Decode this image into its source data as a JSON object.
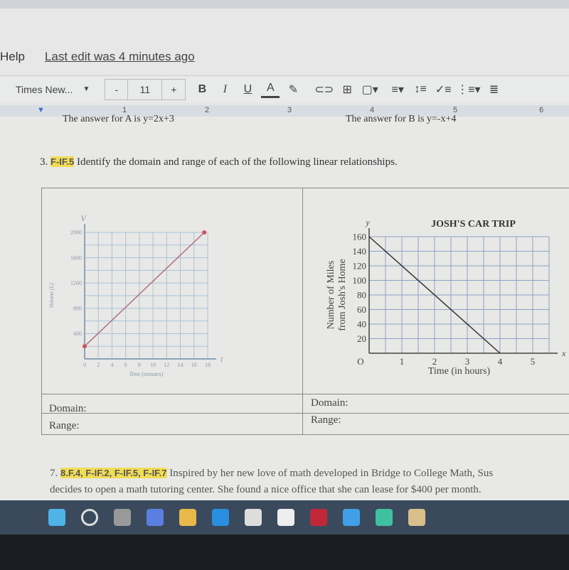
{
  "menu": {
    "help": "Help",
    "last_edit": "Last edit was 4 minutes ago"
  },
  "toolbar": {
    "font": "Times New...",
    "font_size": "11",
    "minus": "-",
    "plus": "+",
    "bold": "B",
    "italic": "I",
    "underline": "U",
    "text_color": "A",
    "icons": [
      "highlighter-icon",
      "link-icon",
      "comment-icon",
      "image-icon",
      "align-icon",
      "line-spacing-icon",
      "checklist-icon",
      "bullet-list-icon",
      "numbered-list-icon"
    ]
  },
  "ruler": {
    "marks": [
      "1",
      "2",
      "3",
      "4",
      "5",
      "6"
    ]
  },
  "doc": {
    "prev_line_a": "The answer for A is y=2x+3",
    "prev_line_b": "The answer for B is y=-x+4",
    "q3_num": "3.",
    "q3_std": "F-IF.5",
    "q3_text": "Identify the domain and range of each of the following linear relationships.",
    "domain_label": "Domain:",
    "range_label": "Range:",
    "q7_num": "7.",
    "q7_std": "8.F.4, F-IF.2, F-IF.5, F-IF.7",
    "q7_line1": "Inspired by her new love of math developed in Bridge to College Math, Sus",
    "q7_line2": "decides to open a math tutoring center. She found a nice office that she can lease for $400 per month."
  },
  "chart_data": [
    {
      "type": "line",
      "title": "",
      "xlabel": "Time (minutes)",
      "ylabel": "Volume (L)",
      "x_axis_var": "t",
      "y_axis_var": "V",
      "x_ticks": [
        "0",
        "2",
        "4",
        "6",
        "8",
        "10",
        "12",
        "14",
        "16",
        "18"
      ],
      "y_ticks": [
        "400",
        "800",
        "1200",
        "1600",
        "2000"
      ],
      "xlim": [
        0,
        18
      ],
      "ylim": [
        0,
        2000
      ],
      "grid": true,
      "points": [
        [
          0,
          200
        ],
        [
          17.5,
          2000
        ]
      ],
      "endpoints": "closed",
      "line_color": "#b07080"
    },
    {
      "type": "line",
      "title": "JOSH'S CAR TRIP",
      "xlabel": "Time (in hours)",
      "ylabel": "Number of Miles from Josh's Home",
      "x_axis_var": "x",
      "y_axis_var": "y",
      "x_ticks": [
        "O",
        "1",
        "2",
        "3",
        "4",
        "5"
      ],
      "y_ticks": [
        "20",
        "40",
        "60",
        "80",
        "100",
        "120",
        "140",
        "160"
      ],
      "xlim": [
        0,
        5.5
      ],
      "ylim": [
        0,
        160
      ],
      "grid": true,
      "points": [
        [
          0,
          160
        ],
        [
          4,
          0
        ]
      ],
      "line_color": "#333333"
    }
  ],
  "taskbar": {
    "icons": [
      "windows-start-icon",
      "search-icon",
      "task-view-icon",
      "chat-icon",
      "file-explorer-icon",
      "edge-icon",
      "store-icon",
      "app-icon",
      "mcafee-icon",
      "help-icon",
      "edge-beta-icon",
      "onedrive-icon"
    ]
  }
}
